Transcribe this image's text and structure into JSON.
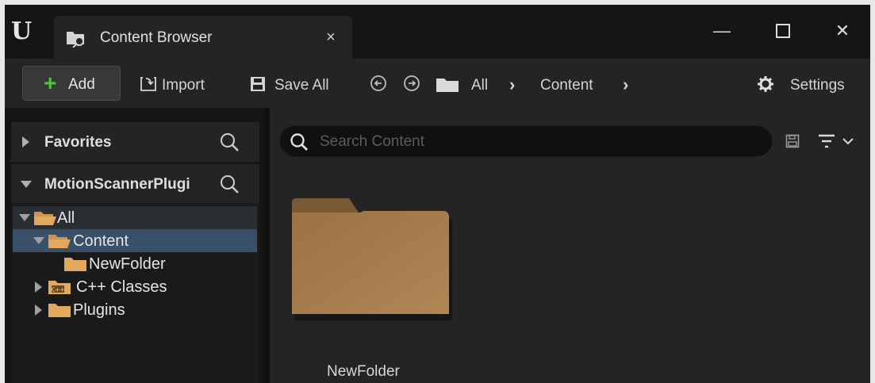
{
  "window": {
    "tab_title": "Content Browser",
    "tab_icon": "content-browser-icon",
    "close_tab_glyph": "×",
    "minimize_glyph": "—",
    "maximize_glyph": "☐",
    "close_glyph": "✕"
  },
  "toolbar": {
    "add_label": "Add",
    "import_label": "Import",
    "save_all_label": "Save All",
    "breadcrumb": [
      "All",
      "Content"
    ],
    "settings_label": "Settings"
  },
  "sidebar": {
    "favorites_label": "Favorites",
    "plugin_section_label": "MotionScannerPlugi",
    "tree": [
      {
        "label": "All",
        "expanded": true
      },
      {
        "label": "Content",
        "expanded": true,
        "selected": true
      },
      {
        "label": "NewFolder"
      },
      {
        "label": "C++ Classes",
        "expanded": false
      },
      {
        "label": "Plugins",
        "expanded": false
      }
    ]
  },
  "content": {
    "search_placeholder": "Search Content",
    "items": [
      {
        "name": "NewFolder",
        "type": "folder"
      }
    ]
  },
  "colors": {
    "accent_green": "#4ec93a",
    "folder": "#a77e4e",
    "selection": "#3a5068"
  }
}
